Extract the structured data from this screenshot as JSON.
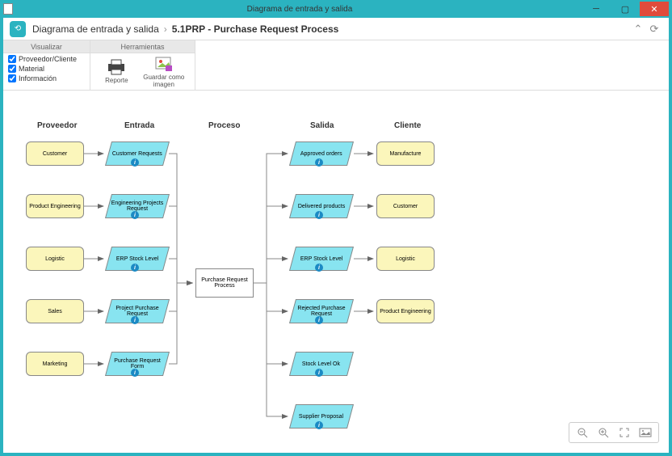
{
  "window": {
    "title": "Diagrama de entrada y salida"
  },
  "breadcrumb": {
    "root": "Diagrama de entrada y salida",
    "current": "5.1PRP - Purchase Request Process"
  },
  "ribbon": {
    "group_visualizar": "Visualizar",
    "group_herramientas": "Herramientas",
    "chk_proveedor": "Proveedor/Cliente",
    "chk_material": "Material",
    "chk_informacion": "Información",
    "btn_reporte": "Reporte",
    "btn_guardar": "Guardar como imagen"
  },
  "headers": {
    "proveedor": "Proveedor",
    "entrada": "Entrada",
    "proceso": "Proceso",
    "salida": "Salida",
    "cliente": "Cliente"
  },
  "proveedores": [
    "Customer",
    "Product Engineering",
    "Logistic",
    "Sales",
    "Marketing"
  ],
  "entradas": [
    "Customer Requests",
    "Engineering Projects Request",
    "ERP Stock Level",
    "Project Purchase Request",
    "Purchase Request Form"
  ],
  "proceso": "Purchase Request Process",
  "salidas": [
    "Approved orders",
    "Delivered products",
    "ERP Stock Level",
    "Rejected Purchase Request",
    "Stock Level Ok",
    "Supplier Proposal"
  ],
  "clientes": [
    "Manufacture",
    "Customer",
    "Logistic",
    "Product Engineering"
  ]
}
